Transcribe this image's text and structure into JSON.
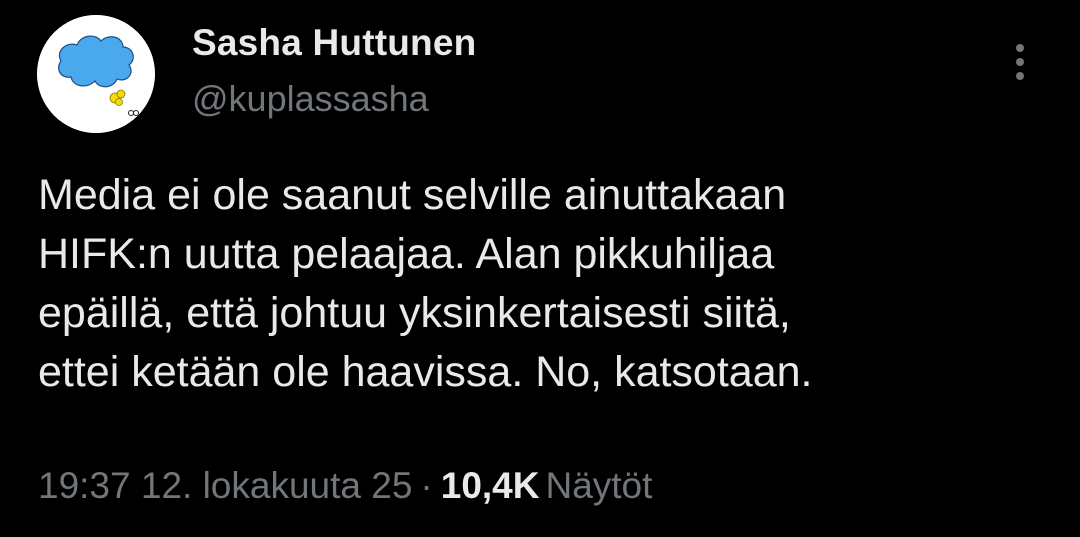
{
  "author": {
    "display_name": "Sasha Huttunen",
    "handle": "@kuplassasha",
    "avatar_icon": "cloud-avatar-icon"
  },
  "more_icon": "vertical-dots-icon",
  "tweet": {
    "lines": [
      "Media ei ole saanut selville ainuttakaan",
      "HIFK:n uutta pelaajaa. Alan pikkuhiljaa",
      "epäillä, että johtuu yksinkertaisesti siitä,",
      "ettei ketään ole haavissa. No, katsotaan."
    ]
  },
  "meta": {
    "time": "19:37",
    "date": "12. lokakuuta 25",
    "separator": "·",
    "views_count": "10,4K",
    "views_label": "Näytöt"
  },
  "colors": {
    "background": "#000000",
    "primary_text": "#e7e9ea",
    "secondary_text": "#71767b",
    "avatar_cloud": "#4aa8ec",
    "avatar_accent": "#f5d90a"
  }
}
